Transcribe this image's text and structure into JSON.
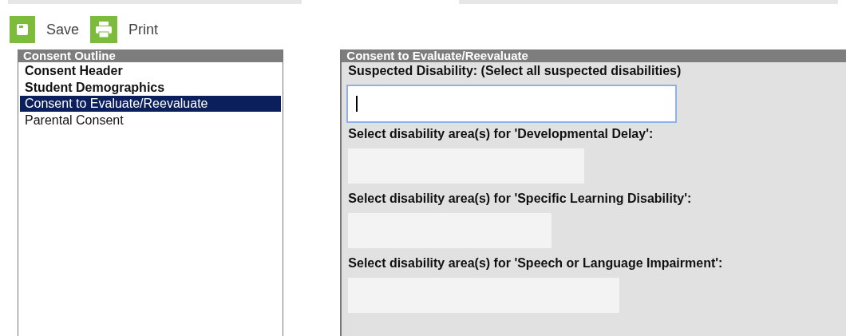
{
  "toolbar": {
    "buttons": [
      {
        "kind": "save",
        "label": "Save"
      },
      {
        "kind": "print",
        "label": "Print"
      }
    ]
  },
  "outline": {
    "title": "Consent Outline",
    "items": [
      {
        "label": "Consent Header",
        "bold": true,
        "selected": false
      },
      {
        "label": "Student Demographics",
        "bold": true,
        "selected": false
      },
      {
        "label": "Consent to Evaluate/Reevaluate",
        "bold": false,
        "selected": true
      },
      {
        "label": "Parental Consent",
        "bold": false,
        "selected": false
      }
    ]
  },
  "editor": {
    "title": "Consent to Evaluate/Reevaluate",
    "fields": [
      {
        "label": "Suspected Disability: (Select all suspected disabilities)",
        "focused": true
      },
      {
        "label": "Select disability area(s) for 'Developmental Delay':",
        "focused": false
      },
      {
        "label": "Select disability area(s) for 'Specific Learning Disability':",
        "focused": false
      },
      {
        "label": "Select disability area(s) for 'Speech or Language Impairment':",
        "focused": false
      }
    ]
  }
}
